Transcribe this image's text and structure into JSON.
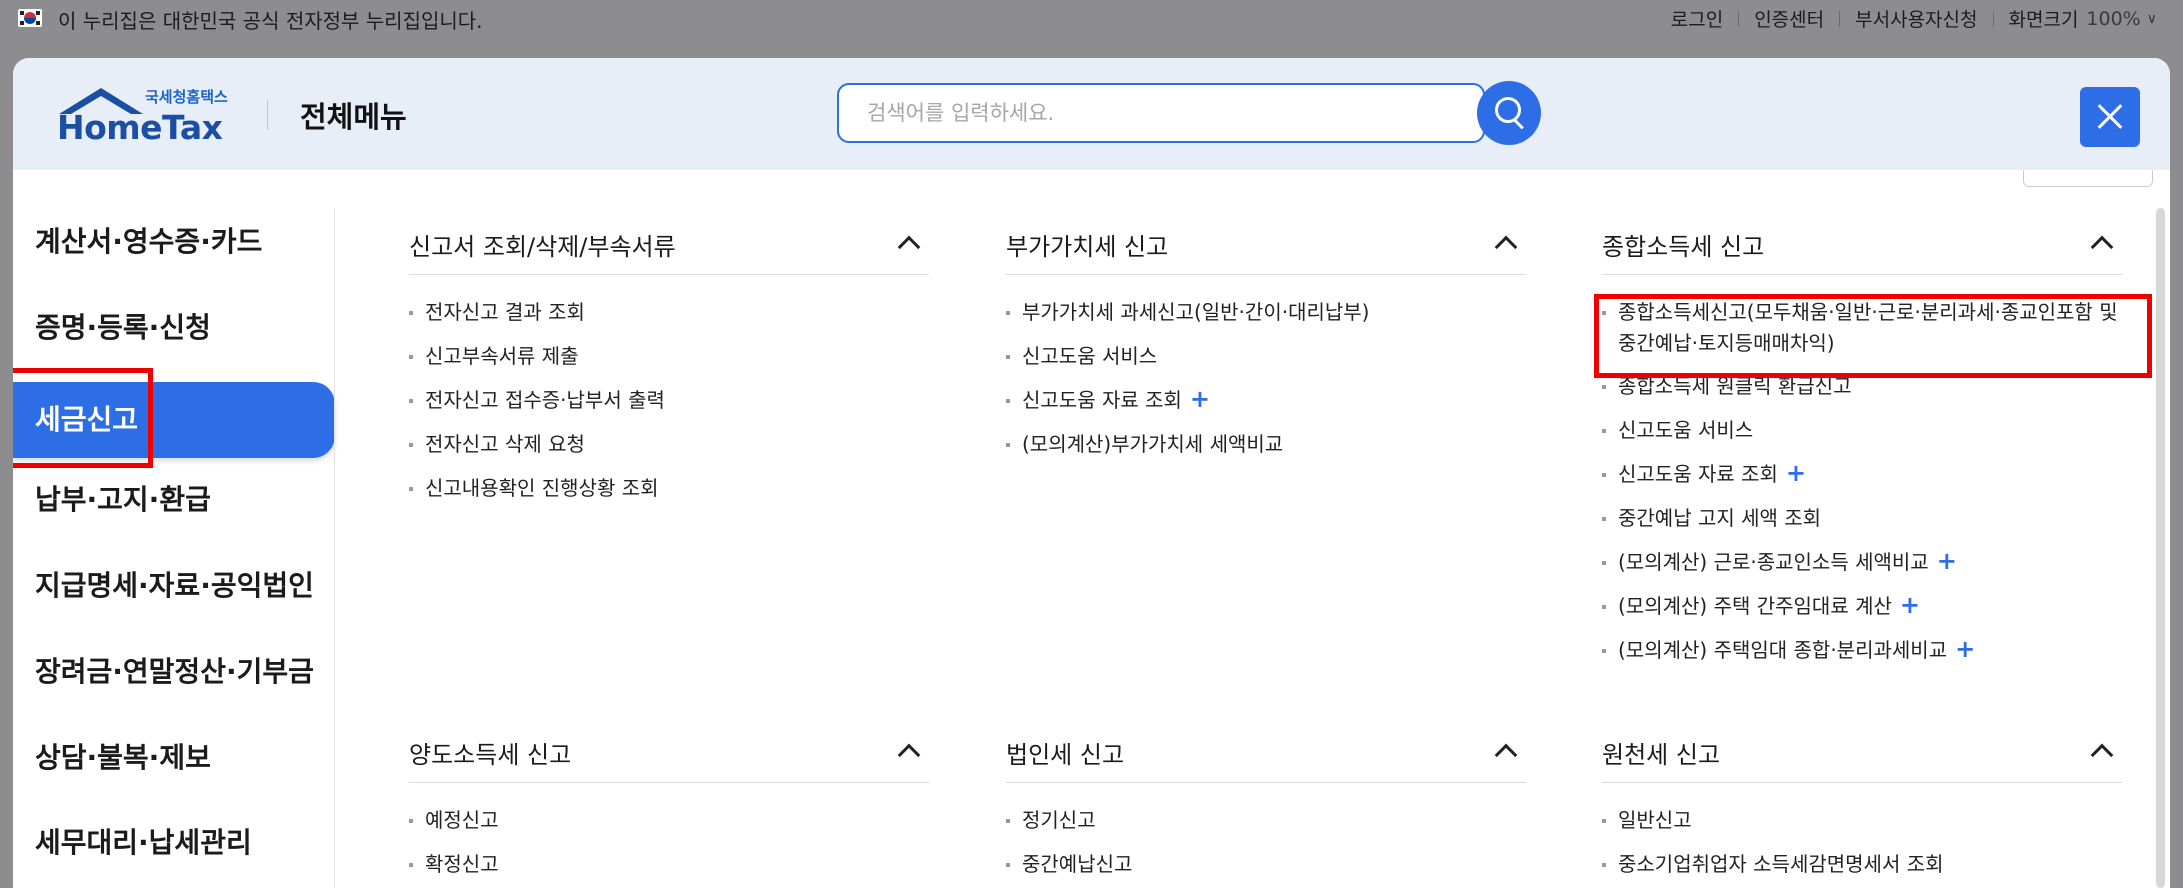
{
  "govbar": {
    "text": "이 누리집은 대한민국 공식 전자정부 누리집입니다.",
    "links": [
      "로그인",
      "인증센터",
      "부서사용자신청",
      "화면크기"
    ],
    "zoom": "100%"
  },
  "header": {
    "logo_sub": "국세청홈택스",
    "logo_name": "HomeTax",
    "title": "전체메뉴",
    "search_placeholder": "검색어를 입력하세요."
  },
  "sidebar": {
    "items": [
      {
        "label": "계산서·영수증·카드"
      },
      {
        "label": "증명·등록·신청"
      },
      {
        "label": "세금신고",
        "active": true
      },
      {
        "label": "납부·고지·환급"
      },
      {
        "label": "지급명세·자료·공익법인"
      },
      {
        "label": "장려금·연말정산·기부금"
      },
      {
        "label": "상담·불복·제보"
      },
      {
        "label": "세무대리·납세관리"
      }
    ]
  },
  "sections": [
    {
      "title": "신고서 조회/삭제/부속서류",
      "items": [
        {
          "label": "전자신고 결과 조회"
        },
        {
          "label": "신고부속서류 제출"
        },
        {
          "label": "전자신고 접수증·납부서 출력"
        },
        {
          "label": "전자신고 삭제 요청"
        },
        {
          "label": "신고내용확인 진행상황 조회"
        }
      ]
    },
    {
      "title": "부가가치세 신고",
      "items": [
        {
          "label": "부가가치세 과세신고(일반·간이·대리납부)"
        },
        {
          "label": "신고도움 서비스"
        },
        {
          "label": "신고도움 자료 조회",
          "plus": "+"
        },
        {
          "label": "(모의계산)부가가치세 세액비교"
        }
      ]
    },
    {
      "title": "종합소득세 신고",
      "items": [
        {
          "label": "종합소득세신고(모두채움·일반·근로·분리과세·종교인포함 및 중간예납·토지등매매차익)",
          "highlighted": true
        },
        {
          "label": "종합소득세 원클릭 환급신고"
        },
        {
          "label": "신고도움 서비스"
        },
        {
          "label": "신고도움 자료 조회",
          "plus": "+"
        },
        {
          "label": "중간예납 고지 세액 조회"
        },
        {
          "label": "(모의계산) 근로·종교인소득 세액비교",
          "plus": "+"
        },
        {
          "label": "(모의계산) 주택 간주임대료 계산",
          "plus": "+"
        },
        {
          "label": "(모의계산) 주택임대 종합·분리과세비교",
          "plus": "+"
        }
      ]
    },
    {
      "title": "양도소득세 신고",
      "items": [
        {
          "label": "예정신고"
        },
        {
          "label": "확정신고"
        }
      ]
    },
    {
      "title": "법인세 신고",
      "items": [
        {
          "label": "정기신고"
        },
        {
          "label": "중간예납신고"
        }
      ]
    },
    {
      "title": "원천세 신고",
      "items": [
        {
          "label": "일반신고"
        },
        {
          "label": "중소기업취업자 소득세감면명세서 조회"
        }
      ]
    }
  ],
  "colors": {
    "accent": "#2d6ee6",
    "highlight": "#ee0000"
  }
}
